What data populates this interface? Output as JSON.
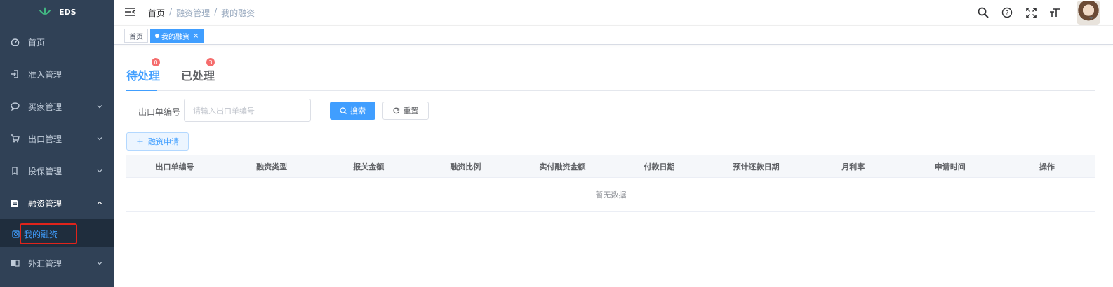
{
  "logo": {
    "text": "EDS",
    "icon": "lotus-logo-icon"
  },
  "sidebar": {
    "items": [
      {
        "label": "首页",
        "icon": "dashboard-icon",
        "chevron": false
      },
      {
        "label": "准入管理",
        "icon": "login-icon",
        "chevron": false
      },
      {
        "label": "买家管理",
        "icon": "chat-icon",
        "chevron": true
      },
      {
        "label": "出口管理",
        "icon": "cart-icon",
        "chevron": true
      },
      {
        "label": "投保管理",
        "icon": "shield-icon",
        "chevron": true
      },
      {
        "label": "融资管理",
        "icon": "document-icon",
        "chevron": true,
        "expanded": true
      },
      {
        "label": "外汇管理",
        "icon": "exchange-icon",
        "chevron": true
      }
    ],
    "sub_item": {
      "label": "我的融资",
      "icon": "finance-icon"
    }
  },
  "header": {
    "breadcrumb": [
      "首页",
      "融资管理",
      "我的融资"
    ],
    "separator": "/",
    "tools": [
      "search-icon",
      "help-icon",
      "fullscreen-icon",
      "font-size-icon"
    ]
  },
  "tags": [
    {
      "label": "首页",
      "active": false
    },
    {
      "label": "我的融资",
      "active": true,
      "close": "×"
    }
  ],
  "tabs": [
    {
      "label": "待处理",
      "badge": "0",
      "active": true
    },
    {
      "label": "已处理",
      "badge": "3",
      "active": false
    }
  ],
  "search": {
    "label": "出口单编号",
    "placeholder": "请输入出口单编号",
    "search_button": "搜索",
    "reset_button": "重置"
  },
  "add_button": "融资申请",
  "table": {
    "columns": [
      "出口单编号",
      "融资类型",
      "报关金额",
      "融资比例",
      "实付融资金额",
      "付款日期",
      "预计还款日期",
      "月利率",
      "申请时间",
      "操作"
    ],
    "empty_text": "暂无数据"
  },
  "colors": {
    "sidebar_bg": "#304156",
    "primary": "#409eff",
    "badge": "#f56c6c",
    "highlight_border": "#e0241b"
  }
}
